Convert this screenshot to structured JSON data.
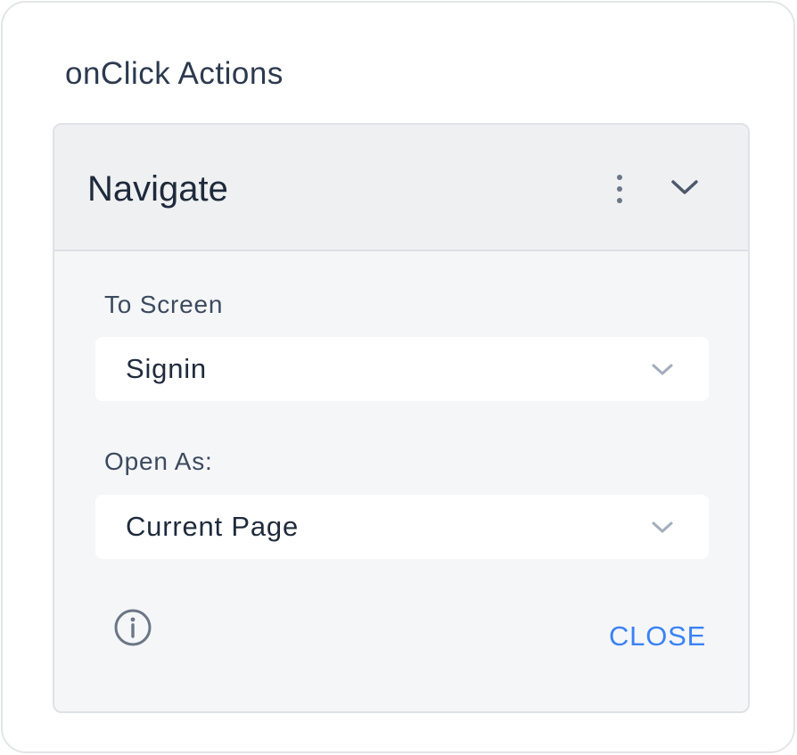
{
  "panel": {
    "title": "onClick Actions"
  },
  "action": {
    "title": "Navigate",
    "menu_icon": "kebab-menu-icon",
    "collapse_icon": "chevron-down-icon",
    "fields": {
      "to_screen": {
        "label": "To Screen",
        "value": "Signin"
      },
      "open_as": {
        "label": "Open As:",
        "value": "Current Page"
      }
    },
    "info_icon": "info-circle-icon",
    "close_label": "CLOSE"
  },
  "colors": {
    "accent": "#3b82f6",
    "text_primary": "#1e2a3b",
    "text_secondary": "#3c4a5e",
    "icon_gray": "#6b7686",
    "card_bg": "#f5f6f8",
    "header_bg": "#eff0f2"
  }
}
